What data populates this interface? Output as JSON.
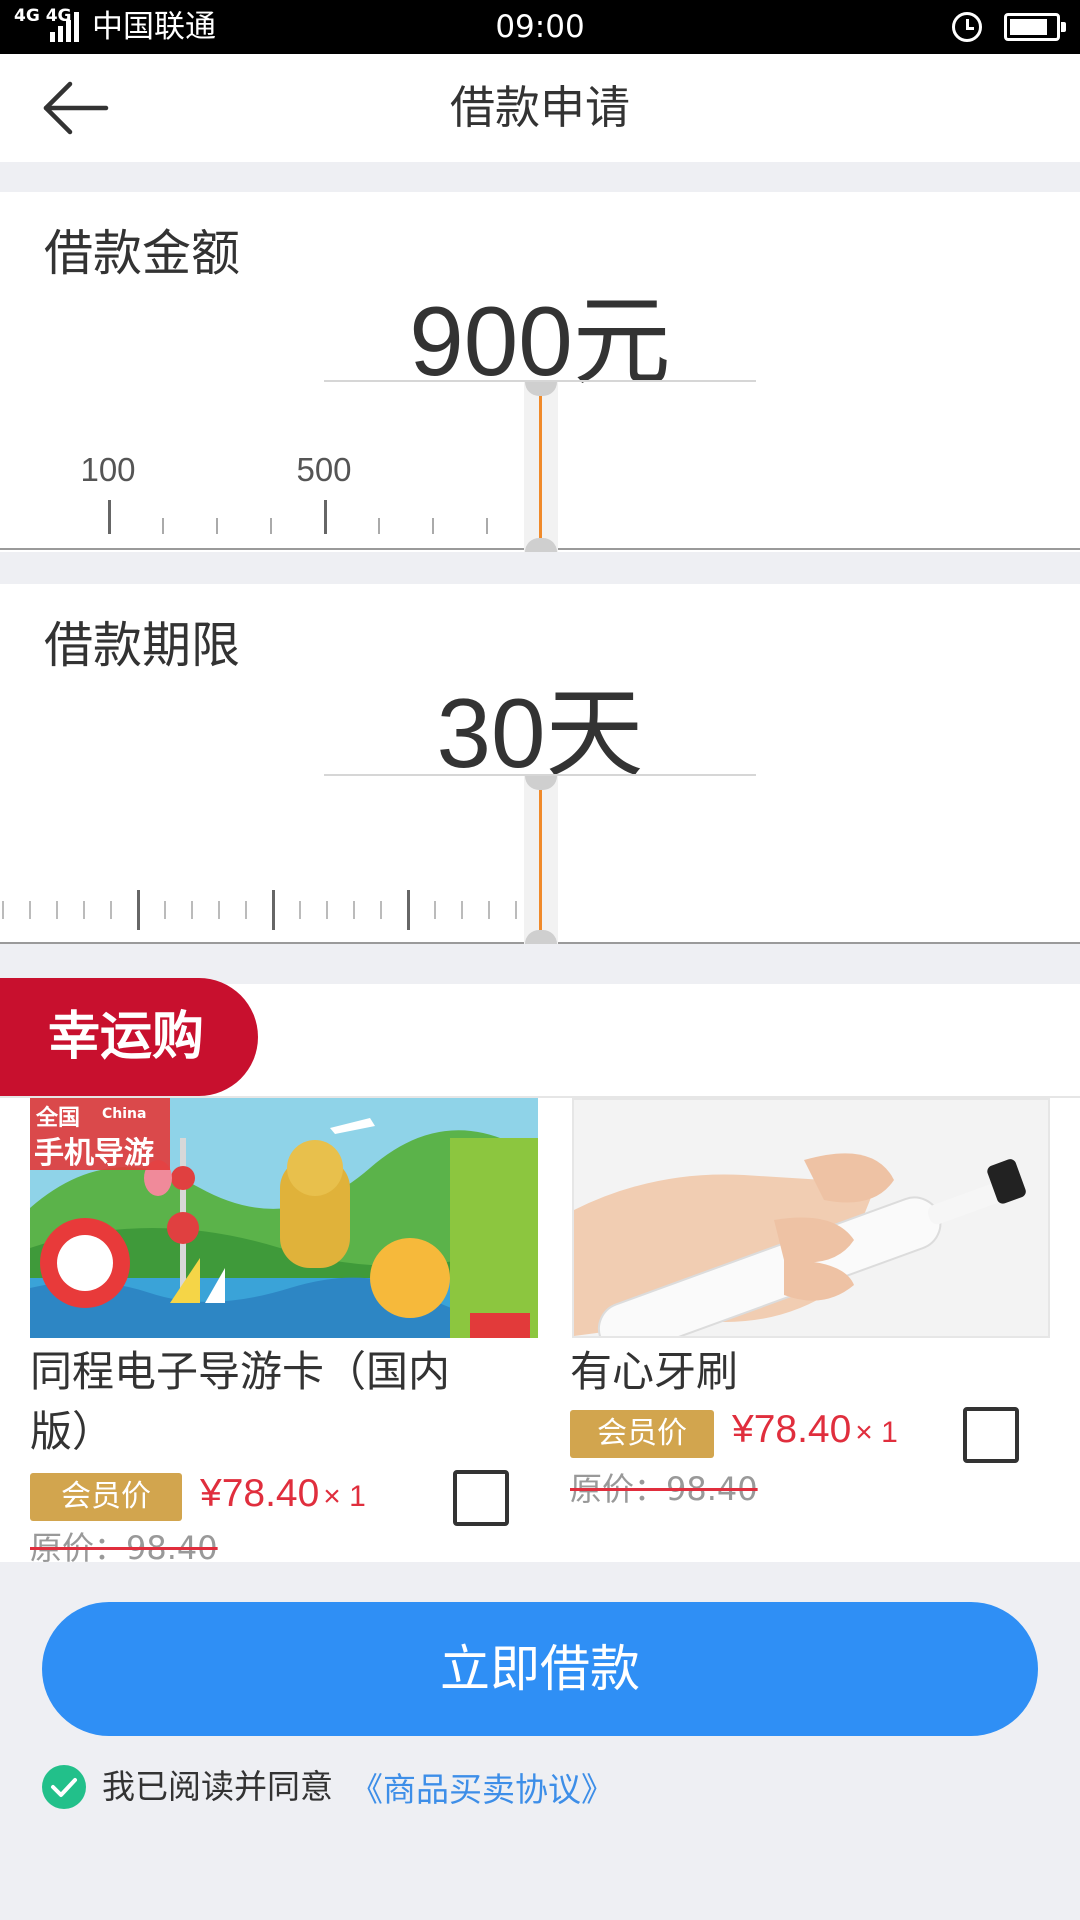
{
  "status_bar": {
    "network": "4G 4G",
    "carrier": "中国联通",
    "time": "09:00",
    "battery_level": 0.85
  },
  "header": {
    "title": "借款申请"
  },
  "loan_amount": {
    "label": "借款金额",
    "value": "900元",
    "ruler_labels": [
      "100",
      "500"
    ]
  },
  "loan_term": {
    "label": "借款期限",
    "value": "30天"
  },
  "lucky_buy": {
    "badge": "幸运购",
    "products": [
      {
        "name": "同程电子导游卡（国内版）",
        "member_tag": "会员价",
        "price": "¥78.40",
        "qty": "× 1",
        "original_price": "原价：98.40",
        "image_text_1": "全国",
        "image_text_2": "手机导游",
        "image_text_3": "China"
      },
      {
        "name": "有心牙刷",
        "member_tag": "会员价",
        "price": "¥78.40",
        "qty": "× 1",
        "original_price": "原价：98.40"
      }
    ]
  },
  "actions": {
    "borrow_button": "立即借款",
    "agree_text": "我已阅读并同意",
    "agreement_link": "《商品买卖协议》"
  },
  "colors": {
    "primary_blue": "#2f8ff5",
    "lucky_red": "#c8102e",
    "slider_orange": "#f08a2a",
    "member_gold": "#d2a54e",
    "price_red": "#e02e3d",
    "check_green": "#22c08a",
    "link_blue": "#3d8ee8"
  }
}
